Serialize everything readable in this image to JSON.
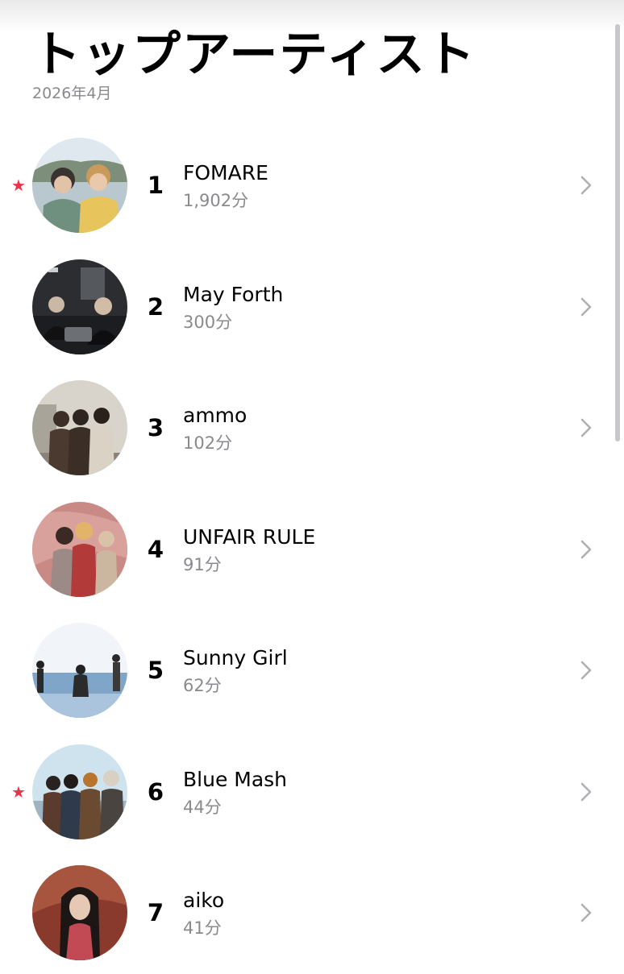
{
  "header": {
    "title": "トップアーティスト",
    "subtitle": "2026年4月"
  },
  "artists": [
    {
      "rank": "1",
      "name": "FOMARE",
      "minutes": "1,902分",
      "favorite": true,
      "star_icon": "★"
    },
    {
      "rank": "2",
      "name": "May Forth",
      "minutes": "300分",
      "favorite": false
    },
    {
      "rank": "3",
      "name": "ammo",
      "minutes": "102分",
      "favorite": false
    },
    {
      "rank": "4",
      "name": "UNFAIR RULE",
      "minutes": "91分",
      "favorite": false
    },
    {
      "rank": "5",
      "name": "Sunny Girl",
      "minutes": "62分",
      "favorite": false
    },
    {
      "rank": "6",
      "name": "Blue Mash",
      "minutes": "44分",
      "favorite": true,
      "star_icon": "★"
    },
    {
      "rank": "7",
      "name": "aiko",
      "minutes": "41分",
      "favorite": false
    }
  ],
  "colors": {
    "favorite_star": "#e8334a",
    "secondary_text": "#8a8a8e",
    "chevron": "#b0b0b5"
  },
  "icons": {
    "favorite": "star-icon",
    "disclosure": "chevron-right-icon"
  }
}
